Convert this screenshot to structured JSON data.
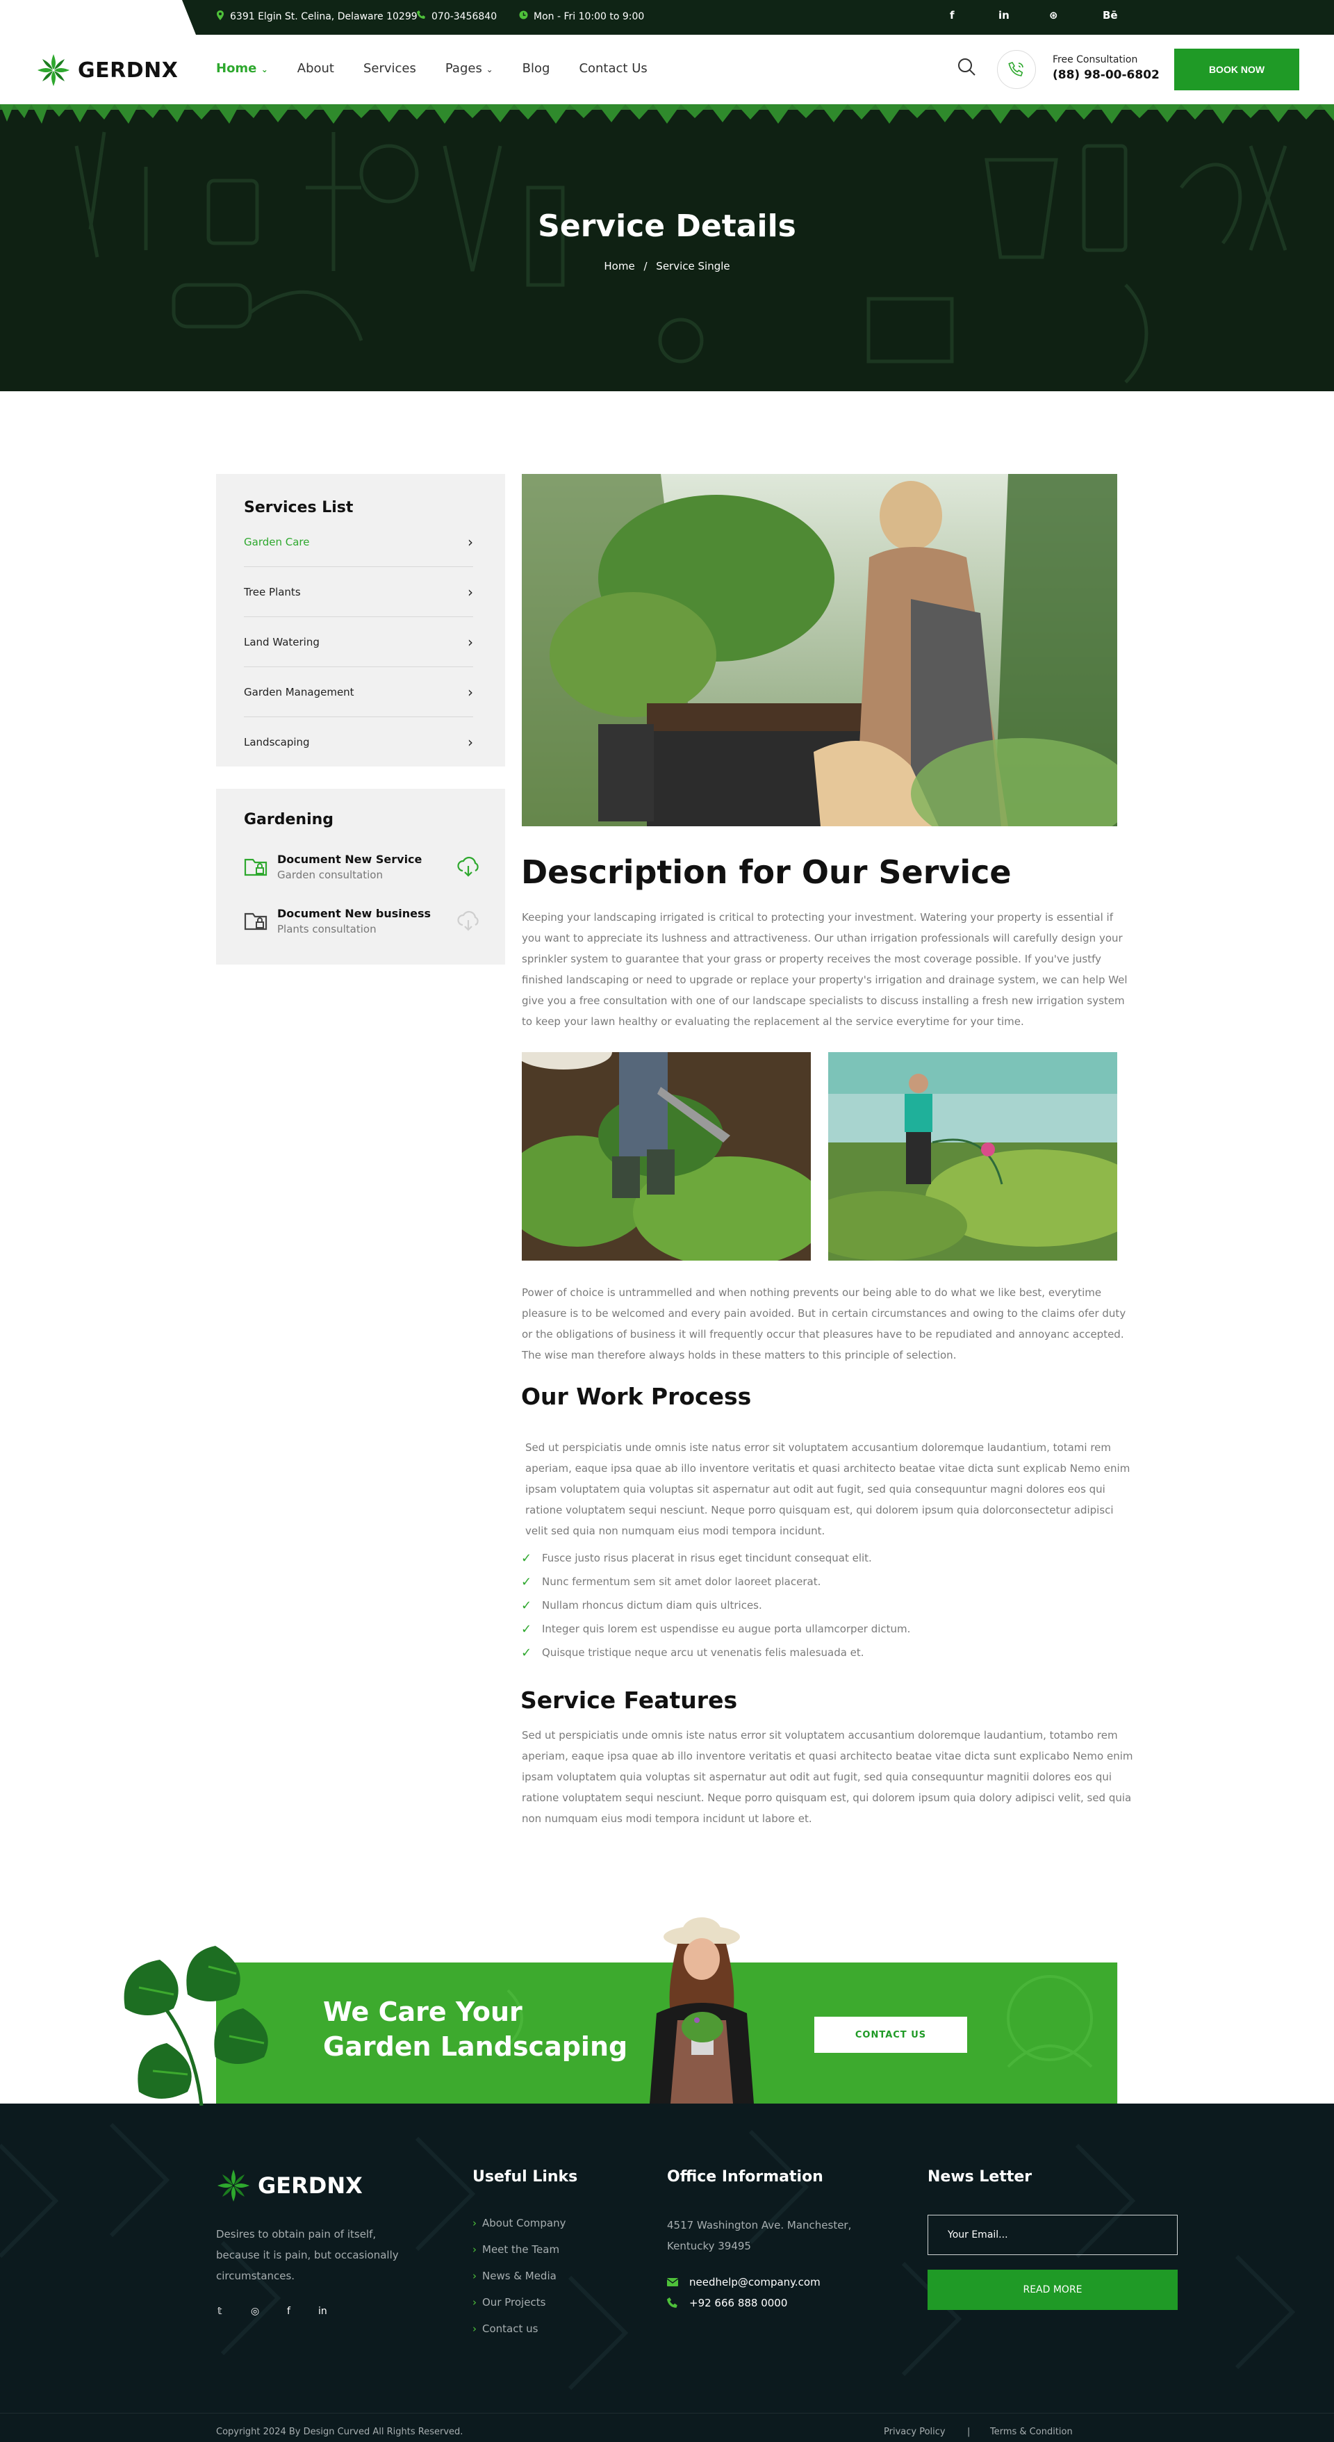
{
  "topbar": {
    "address": "6391 Elgin St. Celina, Delaware 10299",
    "phone": "070-3456840",
    "hours": "Mon - Fri 10:00 to 9:00",
    "social": [
      "f",
      "in",
      "⊛",
      "Bē"
    ]
  },
  "header": {
    "logo": "GERDNX",
    "nav": [
      "Home",
      "About",
      "Services",
      "Pages",
      "Blog",
      "Contact Us"
    ],
    "consult_label": "Free Consultation",
    "consult_phone": "(88) 98-00-6802",
    "book_label": "BOOK NOW"
  },
  "hero": {
    "title": "Service Details",
    "crumb_home": "Home",
    "crumb_sep": "/",
    "crumb_current": "Service Single"
  },
  "sidebar": {
    "services_title": "Services List",
    "services": [
      "Garden Care",
      "Tree Plants",
      "Land Watering",
      "Garden Management",
      "Landscaping"
    ],
    "gardening_title": "Gardening",
    "docs": [
      {
        "title": "Document New Service",
        "sub": "Garden consultation"
      },
      {
        "title": "Document New business",
        "sub": "Plants consultation"
      }
    ]
  },
  "content": {
    "description_title": "Description for Our Service",
    "description_lines": [
      "Keeping your landscaping irrigated is critical to protecting your investment. Watering your property is essential if",
      "you want to appreciate its lushness and attractiveness. Our uthan irrigation professionals will carefully design your",
      "sprinkler system to guarantee that your grass or property receives the most coverage possible. If you've justfy",
      "finished landscaping or need to upgrade or replace your property's irrigation and drainage system, we can help Wel",
      "give you a free consultation with one of our landscape specialists to discuss installing a fresh new irrigation system",
      "to keep your lawn healthy or evaluating the replacement al the service everytime for your time."
    ],
    "choice_lines": [
      "Power of choice is untrammelled and when nothing prevents our being able to do what we like best, everytime",
      "pleasure is to be welcomed and every pain avoided. But in certain circumstances and owing to the claims ofer duty",
      "or the obligations of business it will frequently occur that pleasures have to be repudiated and annoyanc accepted.",
      "The wise man therefore always holds in these matters to this principle of selection."
    ],
    "process_title": "Our Work Process",
    "process_lines": [
      "Sed ut perspiciatis unde omnis iste natus error sit voluptatem accusantium doloremque laudantium, totami rem",
      "aperiam, eaque ipsa quae ab illo inventore veritatis et quasi architecto beatae vitae dicta sunt explicab Nemo enim",
      "ipsam voluptatem quia voluptas sit aspernatur aut odit aut fugit, sed quia consequuntur magni dolores eos qui",
      "ratione voluptatem sequi nesciunt. Neque porro quisquam est, qui dolorem ipsum quia dolorconsectetur adipisci",
      "velit sed quia non numquam eius modi tempora incidunt."
    ],
    "checklist": [
      "Fusce justo risus placerat in risus eget tincidunt consequat elit.",
      "Nunc fermentum sem sit amet dolor laoreet placerat.",
      "Nullam rhoncus dictum diam quis ultrices.",
      "Integer quis lorem est uspendisse eu augue porta ullamcorper dictum.",
      "Quisque tristique neque arcu ut venenatis felis malesuada et."
    ],
    "features_title": "Service Features",
    "features_lines": [
      "Sed ut perspiciatis unde omnis iste natus error sit voluptatem accusantium doloremque laudantium, totambo rem",
      "aperiam, eaque ipsa quae ab illo inventore veritatis et quasi architecto beatae vitae dicta sunt explicabo Nemo enim",
      "ipsam voluptatem quia voluptas sit aspernatur aut odit aut fugit, sed quia consequuntur magnitii dolores eos qui",
      "ratione voluptatem sequi nesciunt. Neque porro quisquam est, qui dolorem ipsum quia dolory  adipisci velit, sed quia",
      "non numquam eius modi tempora incidunt ut labore et."
    ]
  },
  "cta": {
    "line1": "We Care Your",
    "line2": "Garden Landscaping",
    "button": "CONTACT US"
  },
  "footer": {
    "logo": "GERDNX",
    "about_lines": [
      "Desires to obtain pain of itself,",
      "because it is pain, but occasionally",
      "circumstances."
    ],
    "social": [
      "𝕥",
      "◎",
      "f",
      "in"
    ],
    "useful_title": "Useful Links",
    "useful_links": [
      "About Company",
      "Meet the Team",
      "News & Media",
      "Our Projects",
      "Contact us"
    ],
    "office_title": "Office Information",
    "office_address_1": "4517 Washington Ave. Manchester,",
    "office_address_2": "Kentucky 39495",
    "office_email": "needhelp@company.com",
    "office_phone": "+92 666 888 0000",
    "news_title": "News Letter",
    "news_placeholder": "Your Email...",
    "news_button": "READ MORE",
    "copyright": "Copyright  2024 By Design Curved All Rights Reserved.",
    "privacy": "Privacy Policy",
    "divider": "|",
    "terms": "Terms & Condition"
  },
  "colors": {
    "brand_green": "#1f9a26",
    "dark_green": "#0f2415",
    "footer_bg": "#0c1a1e"
  }
}
